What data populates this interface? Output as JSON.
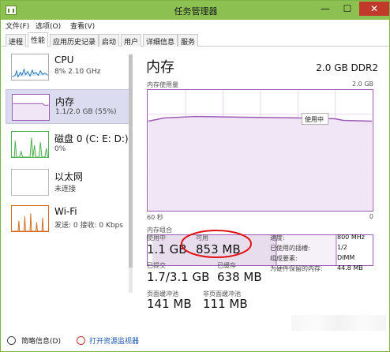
{
  "window": {
    "title": "任务管理器",
    "controls": {
      "minimize": "—",
      "maximize": "☐",
      "close": "✕"
    }
  },
  "menu": [
    "文件(F)",
    "选项(O)",
    "查看(V)"
  ],
  "tabs": [
    "进程",
    "性能",
    "应用历史记录",
    "启动",
    "用户",
    "详细信息",
    "服务"
  ],
  "active_tab": "性能",
  "sidebar": {
    "items": [
      {
        "name": "CPU",
        "sub": "8% 2.10 GHz",
        "color": "#1f77b4"
      },
      {
        "name": "内存",
        "sub": "1.1/2.0 GB (55%)",
        "color": "#8e44ad"
      },
      {
        "name": "磁盘 0 (C: E: D:)",
        "sub": "0%",
        "color": "#4caf50"
      },
      {
        "name": "以太网",
        "sub": "未连接",
        "color": "#b0b0b0"
      },
      {
        "name": "Wi-Fi",
        "sub": "发送: 0 接收: 0 Kbps",
        "color": "#d2691e"
      }
    ],
    "selected": "内存"
  },
  "main": {
    "title": "内存",
    "capacity": "2.0 GB DDR2",
    "usage_label": "内存使用量",
    "usage_max": "2.0 GB",
    "axis_left": "60 秒",
    "axis_right": "0",
    "tooltip": "使用中",
    "composition_label": "内存组合"
  },
  "stats": {
    "in_use_label": "使用中",
    "in_use": "1.1 GB",
    "available_label": "可用",
    "available": "853 MB",
    "committed_label": "已提交",
    "committed": "1.7/3.1 GB",
    "cached_label": "已缓存",
    "cached": "638 MB",
    "paged_label": "页面缓冲池",
    "paged": "141 MB",
    "nonpaged_label": "非页面缓冲池",
    "nonpaged": "111 MB"
  },
  "details": [
    {
      "label": "速度:",
      "value": "800 MHz"
    },
    {
      "label": "已使用的插槽:",
      "value": "1/2"
    },
    {
      "label": "组成要素:",
      "value": "DIMM"
    },
    {
      "label": "为硬件保留的内存:",
      "value": "44.8 MB"
    }
  ],
  "footer": {
    "summary": "简略信息(D)",
    "monitor_link": "打开资源监视器"
  },
  "colors": {
    "titlebar": "#8cc152",
    "memory_purple": "#9b59b6",
    "annotation_red": "#e01010"
  }
}
